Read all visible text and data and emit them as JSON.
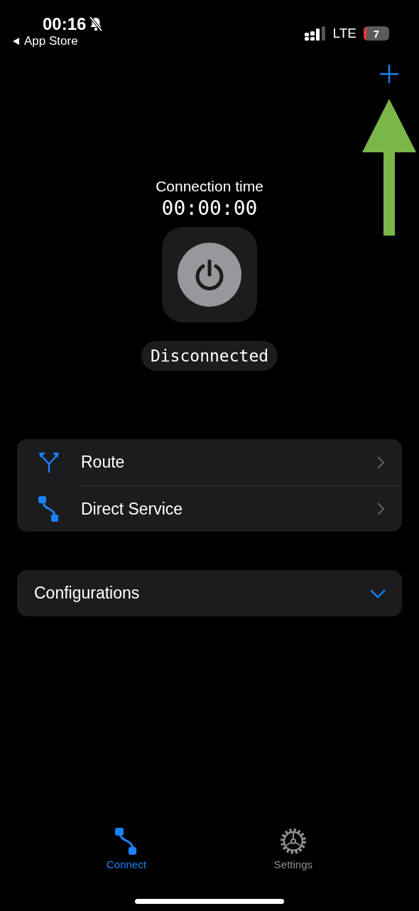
{
  "status_bar": {
    "time": "00:16",
    "back_label": "App Store",
    "network": "LTE",
    "battery": "7"
  },
  "connection": {
    "label": "Connection time",
    "timer": "00:00:00",
    "status": "Disconnected",
    "connected": false
  },
  "menu": [
    {
      "kind": "route",
      "label": "Route"
    },
    {
      "kind": "direct",
      "label": "Direct Service"
    }
  ],
  "configurations": {
    "label": "Configurations",
    "expanded": false
  },
  "tabs": [
    {
      "kind": "connect",
      "label": "Connect",
      "selected": true
    },
    {
      "kind": "settings",
      "label": "Settings",
      "selected": false
    }
  ]
}
